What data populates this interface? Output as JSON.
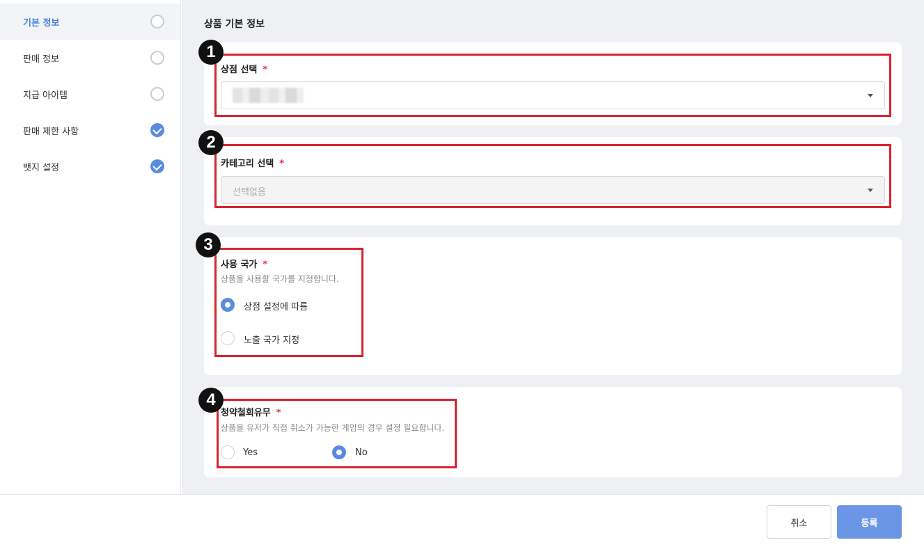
{
  "sidebar": {
    "items": [
      {
        "label": "기본 정보",
        "done": false,
        "active": true
      },
      {
        "label": "판매 정보",
        "done": false,
        "active": false
      },
      {
        "label": "지급 아이템",
        "done": false,
        "active": false
      },
      {
        "label": "판매 제한 사항",
        "done": true,
        "active": false
      },
      {
        "label": "뱃지 설정",
        "done": true,
        "active": false
      }
    ]
  },
  "main": {
    "section_title": "상품 기본 정보",
    "store_select": {
      "label": "상점 선택",
      "required_mark": "*",
      "value": ""
    },
    "category_select": {
      "label": "카테고리 선택",
      "required_mark": "*",
      "placeholder": "선택없음"
    },
    "country": {
      "label": "사용 국가",
      "required_mark": "*",
      "description": "상품을 사용할 국가를 지정합니다.",
      "options": [
        {
          "label": "상점 설정에 따름",
          "selected": true
        },
        {
          "label": "노출 국가 지정",
          "selected": false
        }
      ]
    },
    "withdrawal": {
      "label": "청약철회유무",
      "required_mark": "*",
      "description": "상품을 유저가 직접 취소가 가능한 게임의 경우 설정 필요합니다.",
      "options": [
        {
          "label": "Yes",
          "selected": false
        },
        {
          "label": "No",
          "selected": true
        }
      ]
    }
  },
  "annotations": {
    "badges": [
      "1",
      "2",
      "3",
      "4"
    ],
    "color": "#d9232f"
  },
  "footer": {
    "cancel_label": "취소",
    "submit_label": "등록"
  },
  "colors": {
    "accent": "#5a8be0",
    "submit": "#6b96e6",
    "required": "#e0334a"
  }
}
